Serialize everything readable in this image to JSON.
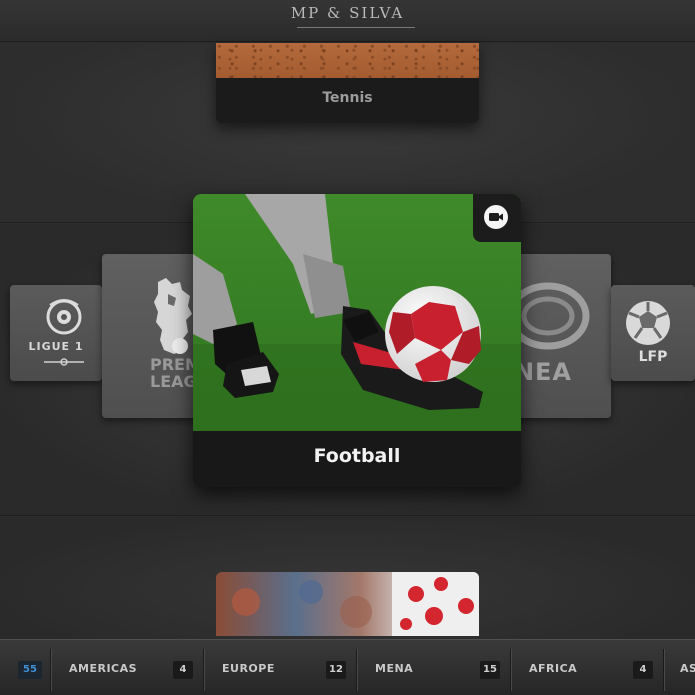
{
  "header": {
    "brand": "MP & SILVA"
  },
  "carousel_top": {
    "label": "Tennis"
  },
  "featured": {
    "label": "Football",
    "badge_icon": "video-camera-icon"
  },
  "tiles": {
    "ligue1": "LIGUE 1",
    "premier": "PREM\nLEAG",
    "serie": "NEA",
    "lfp": "LFP"
  },
  "nav": {
    "all_count": "55",
    "items": [
      {
        "label": "AMERICAS",
        "count": "4"
      },
      {
        "label": "EUROPE",
        "count": "12"
      },
      {
        "label": "MENA",
        "count": "15"
      },
      {
        "label": "AFRICA",
        "count": "4"
      },
      {
        "label": "AS",
        "count": ""
      }
    ]
  },
  "colors": {
    "background": "#2c2c2c",
    "card": "#181818",
    "pitch": "#3f8a2a",
    "ball_red": "#c8202e",
    "count_accent": "#3f8fd2"
  }
}
